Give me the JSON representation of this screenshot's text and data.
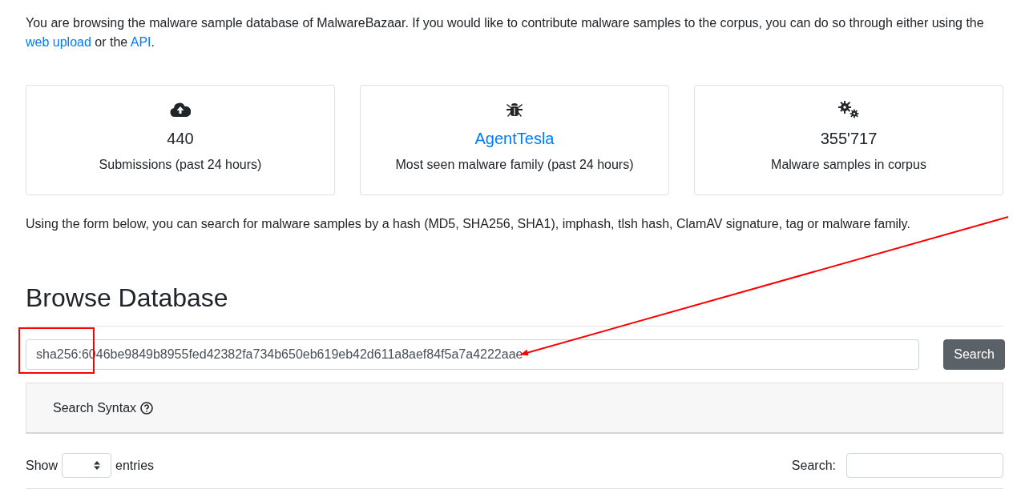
{
  "intro": [
    {
      "kind": "text",
      "text": "You are browsing the malware sample database of MalwareBazaar. If you would like to contribute malware samples to the corpus, you can do so through either using the "
    },
    {
      "kind": "link",
      "text": "web upload"
    },
    {
      "kind": "text",
      "text": " or the "
    },
    {
      "kind": "link",
      "text": "API"
    },
    {
      "kind": "text",
      "text": "."
    }
  ],
  "stats": [
    {
      "value": "440",
      "kind": "text",
      "label": "Submissions (past 24 hours)"
    },
    {
      "value": "AgentTesla",
      "kind": "link",
      "label": "Most seen malware family (past 24 hours)"
    },
    {
      "value": "355'717",
      "kind": "text",
      "label": "Malware samples in corpus"
    }
  ],
  "form_hint": "Using the form below, you can search for malware samples by a hash (MD5, SHA256, SHA1), imphash, tlsh hash, ClamAV signature, tag or malware family.",
  "heading": "Browse Database",
  "search": {
    "value": "sha256:6046be9849b8955fed42382fa734b650eb619eb42d611a8aef84f5a7a4222aae",
    "button": "Search"
  },
  "syntax_panel": {
    "label": "Search Syntax"
  },
  "table_controls": {
    "show": "Show",
    "entries": "entries",
    "search_label": "Search:"
  },
  "annotations": {
    "highlight_box": true,
    "arrow": true
  }
}
